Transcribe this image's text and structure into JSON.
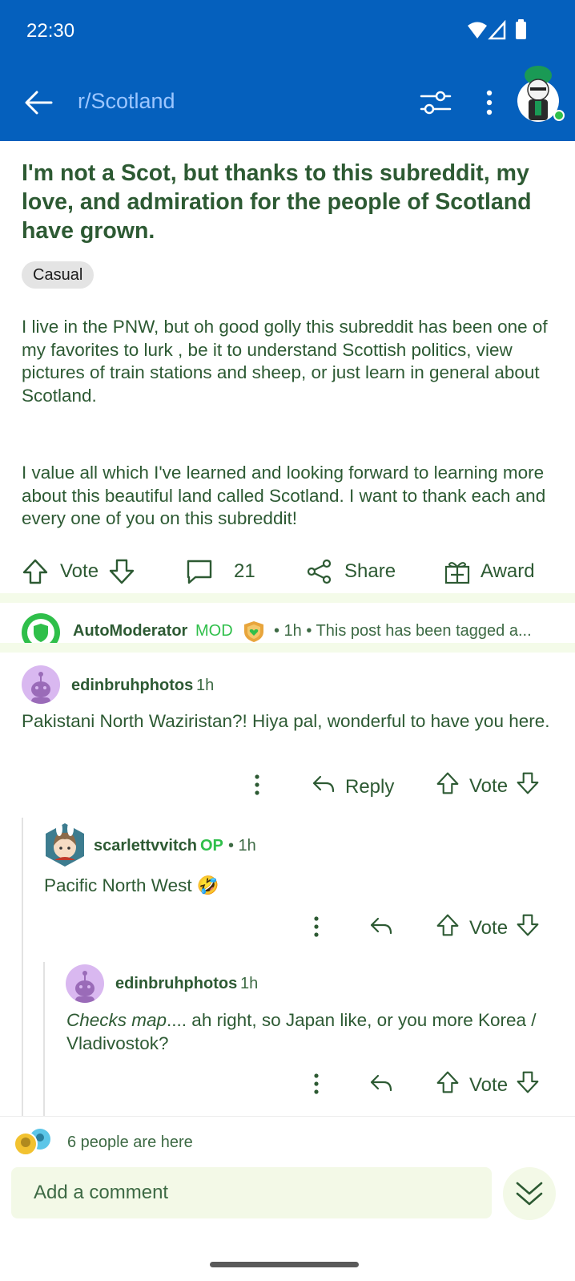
{
  "status_bar": {
    "time": "22:30"
  },
  "app_bar": {
    "subreddit": "r/Scotland"
  },
  "post": {
    "title": "I'm not a Scot, but thanks to this subreddit, my love, and admiration for the people of Scotland have grown.",
    "flair": "Casual",
    "body": [
      "I live in the PNW, but oh good golly this subreddit has been one of my favorites to lurk , be it to understand Scottish politics, view pictures of train stations and sheep, or just learn in general about Scotland.",
      "I value all which I've learned and looking forward to learning more about this beautiful land called Scotland.  I want to thank each and every one of you on this subreddit!"
    ],
    "actions": {
      "vote": "Vote",
      "comments": "21",
      "share": "Share",
      "award": "Award"
    }
  },
  "automod": {
    "name": "AutoModerator",
    "tag": "MOD",
    "meta": "• 1h • This post has been tagged a..."
  },
  "comments": [
    {
      "user": "edinbruhphotos",
      "time": "1h",
      "text": "Pakistani North Waziristan?! Hiya pal, wonderful to have you here.",
      "reply_label": "Reply",
      "vote_label": "Vote"
    },
    {
      "user": "scarlettvvitch",
      "op": "OP",
      "time": "• 1h",
      "text": "Pacific North West 🤣",
      "vote_label": "Vote"
    },
    {
      "user": "edinbruhphotos",
      "time": "1h",
      "text_italic": "Checks map",
      "text_rest": ".... ah right, so Japan like, or you more Korea / Vladivostok?",
      "vote_label": "Vote"
    }
  ],
  "presence": {
    "text": "6 people are here"
  },
  "composer": {
    "placeholder": "Add a comment"
  },
  "colors": {
    "app_bar": "#0560bd",
    "text_green": "#2d5a33",
    "mod_green": "#2fbf4a",
    "composer_bg": "#f3f9e7"
  }
}
